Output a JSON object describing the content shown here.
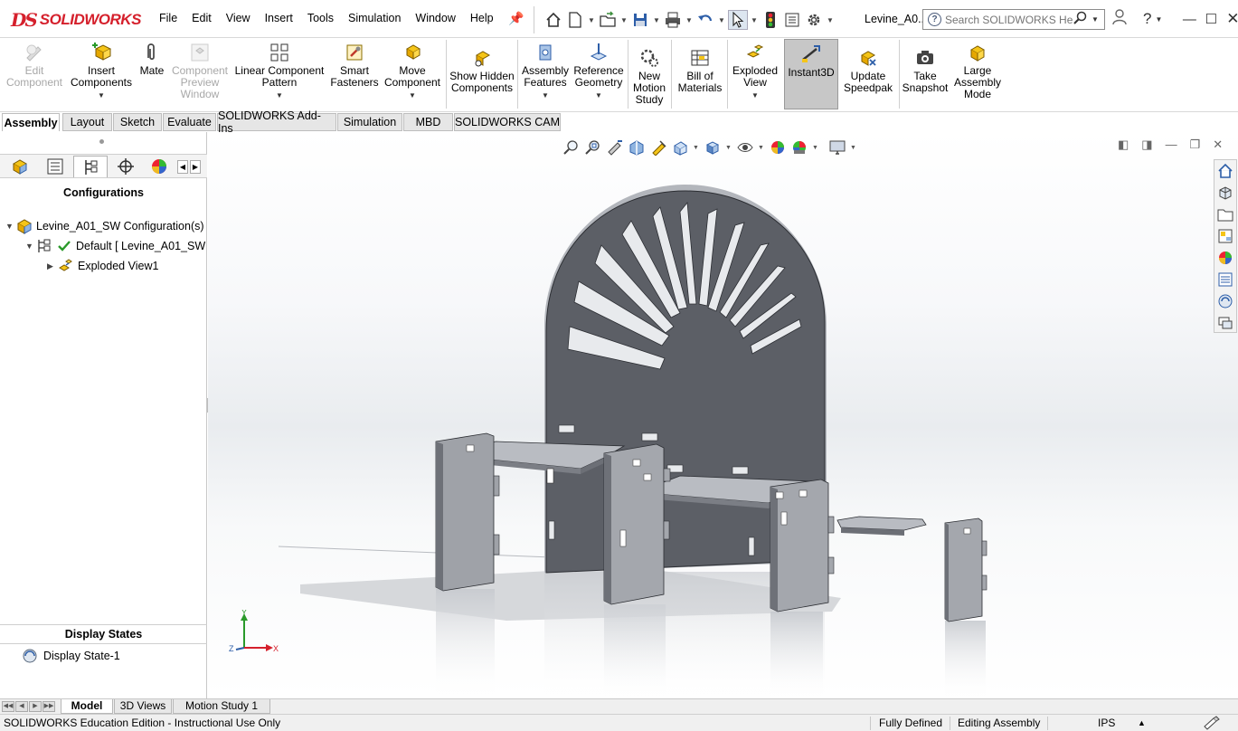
{
  "app": {
    "logo_ds": "DS",
    "logo_text": "SOLIDWORKS",
    "document_title": "Levine_A0...",
    "search_placeholder": "Search SOLIDWORKS Help"
  },
  "menu": [
    "File",
    "Edit",
    "View",
    "Insert",
    "Tools",
    "Simulation",
    "Window",
    "Help"
  ],
  "ribbon": {
    "edit_component": "Edit Component",
    "insert_components": "Insert Components",
    "mate": "Mate",
    "component_preview": "Component Preview Window",
    "linear_pattern": "Linear Component Pattern",
    "smart_fasteners": "Smart Fasteners",
    "move_component": "Move Component",
    "show_hidden": "Show Hidden Components",
    "assembly_features": "Assembly Features",
    "reference_geometry": "Reference Geometry",
    "new_motion_study": "New Motion Study",
    "bill_of_materials": "Bill of Materials",
    "exploded_view": "Exploded View",
    "instant3d": "Instant3D",
    "update_speedpak": "Update Speedpak",
    "take_snapshot": "Take Snapshot",
    "large_assembly_mode": "Large Assembly Mode"
  },
  "command_tabs": [
    "Assembly",
    "Layout",
    "Sketch",
    "Evaluate",
    "SOLIDWORKS Add-Ins",
    "Simulation",
    "MBD",
    "SOLIDWORKS CAM"
  ],
  "left_panel": {
    "configurations_title": "Configurations",
    "tree": [
      "Levine_A01_SW Configuration(s)",
      "Default [ Levine_A01_SW",
      "Exploded View1"
    ],
    "display_states_title": "Display States",
    "display_state": "Display State-1"
  },
  "triad": {
    "x": "X",
    "y": "Y",
    "z": "Z"
  },
  "bottom_tabs": [
    "Model",
    "3D Views",
    "Motion Study 1"
  ],
  "status": {
    "edition": "SOLIDWORKS Education Edition - Instructional Use Only",
    "defined": "Fully Defined",
    "mode": "Editing Assembly",
    "units": "IPS"
  },
  "colors": {
    "brand_red": "#d5202c",
    "part_gray": "#5c5f66",
    "selection_blue": "#dde6f0"
  }
}
